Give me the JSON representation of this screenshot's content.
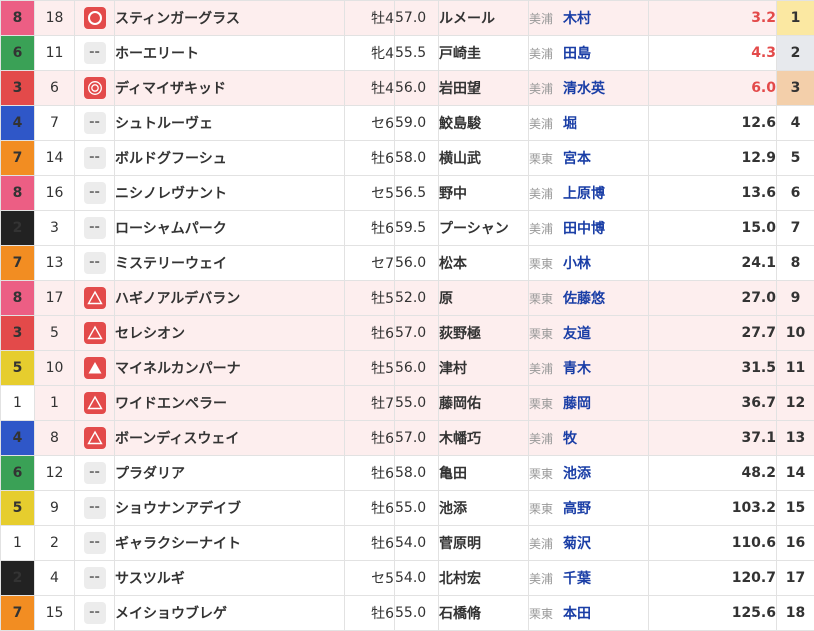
{
  "colors": {
    "waku1": "#ffffff",
    "waku2": "#222222",
    "waku3": "#e34a4a",
    "waku4": "#2f57c8",
    "waku5": "#e6cd2e",
    "waku6": "#3aa156",
    "waku7": "#f28d22",
    "waku8": "#ec5e84",
    "mark_red": "#e34a4a",
    "name_blue": "#1a3ea6",
    "fav_odds": "#e34a4a"
  },
  "rows": [
    {
      "waku": "8",
      "umaban": "18",
      "mark": "double-circle",
      "name": "スティンガーグラス",
      "sexage": "牡4",
      "kinryo": "57.0",
      "jockey": "ルメール",
      "aff": "美浦",
      "trainer": "木村",
      "odds": "3.2",
      "ninki": "1",
      "hl": true
    },
    {
      "waku": "6",
      "umaban": "11",
      "mark": "none",
      "name": "ホーエリート",
      "sexage": "牝4",
      "kinryo": "55.5",
      "jockey": "戸崎圭",
      "aff": "美浦",
      "trainer": "田島",
      "odds": "4.3",
      "ninki": "2",
      "hl": false
    },
    {
      "waku": "3",
      "umaban": "6",
      "mark": "target",
      "name": "ディマイザキッド",
      "sexage": "牡4",
      "kinryo": "56.0",
      "jockey": "岩田望",
      "aff": "美浦",
      "trainer": "清水英",
      "odds": "6.0",
      "ninki": "3",
      "hl": true
    },
    {
      "waku": "4",
      "umaban": "7",
      "mark": "none",
      "name": "シュトルーヴェ",
      "sexage": "セ6",
      "kinryo": "59.0",
      "jockey": "鮫島駿",
      "aff": "美浦",
      "trainer": "堀",
      "odds": "12.6",
      "ninki": "4",
      "hl": false
    },
    {
      "waku": "7",
      "umaban": "14",
      "mark": "none",
      "name": "ボルドグフーシュ",
      "sexage": "牡6",
      "kinryo": "58.0",
      "jockey": "横山武",
      "aff": "栗東",
      "trainer": "宮本",
      "odds": "12.9",
      "ninki": "5",
      "hl": false
    },
    {
      "waku": "8",
      "umaban": "16",
      "mark": "none",
      "name": "ニシノレヴナント",
      "sexage": "セ5",
      "kinryo": "56.5",
      "jockey": "野中",
      "aff": "美浦",
      "trainer": "上原博",
      "odds": "13.6",
      "ninki": "6",
      "hl": false
    },
    {
      "waku": "2",
      "umaban": "3",
      "mark": "none",
      "name": "ローシャムパーク",
      "sexage": "牡6",
      "kinryo": "59.5",
      "jockey": "プーシャン",
      "aff": "美浦",
      "trainer": "田中博",
      "odds": "15.0",
      "ninki": "7",
      "hl": false
    },
    {
      "waku": "7",
      "umaban": "13",
      "mark": "none",
      "name": "ミステリーウェイ",
      "sexage": "セ7",
      "kinryo": "56.0",
      "jockey": "松本",
      "aff": "栗東",
      "trainer": "小林",
      "odds": "24.1",
      "ninki": "8",
      "hl": false
    },
    {
      "waku": "8",
      "umaban": "17",
      "mark": "triangle-outline",
      "name": "ハギノアルデバラン",
      "sexage": "牡5",
      "kinryo": "52.0",
      "jockey": "原",
      "aff": "栗東",
      "trainer": "佐藤悠",
      "odds": "27.0",
      "ninki": "9",
      "hl": true
    },
    {
      "waku": "3",
      "umaban": "5",
      "mark": "triangle-outline",
      "name": "セレシオン",
      "sexage": "牡6",
      "kinryo": "57.0",
      "jockey": "荻野極",
      "aff": "栗東",
      "trainer": "友道",
      "odds": "27.7",
      "ninki": "10",
      "hl": true
    },
    {
      "waku": "5",
      "umaban": "10",
      "mark": "triangle-filled",
      "name": "マイネルカンパーナ",
      "sexage": "牡5",
      "kinryo": "56.0",
      "jockey": "津村",
      "aff": "美浦",
      "trainer": "青木",
      "odds": "31.5",
      "ninki": "11",
      "hl": true
    },
    {
      "waku": "1",
      "umaban": "1",
      "mark": "triangle-outline",
      "name": "ワイドエンペラー",
      "sexage": "牡7",
      "kinryo": "55.0",
      "jockey": "藤岡佑",
      "aff": "栗東",
      "trainer": "藤岡",
      "odds": "36.7",
      "ninki": "12",
      "hl": true
    },
    {
      "waku": "4",
      "umaban": "8",
      "mark": "triangle-outline",
      "name": "ボーンディスウェイ",
      "sexage": "牡6",
      "kinryo": "57.0",
      "jockey": "木幡巧",
      "aff": "美浦",
      "trainer": "牧",
      "odds": "37.1",
      "ninki": "13",
      "hl": true
    },
    {
      "waku": "6",
      "umaban": "12",
      "mark": "none",
      "name": "プラダリア",
      "sexage": "牡6",
      "kinryo": "58.0",
      "jockey": "亀田",
      "aff": "栗東",
      "trainer": "池添",
      "odds": "48.2",
      "ninki": "14",
      "hl": false
    },
    {
      "waku": "5",
      "umaban": "9",
      "mark": "none",
      "name": "ショウナンアデイブ",
      "sexage": "牡6",
      "kinryo": "55.0",
      "jockey": "池添",
      "aff": "栗東",
      "trainer": "高野",
      "odds": "103.2",
      "ninki": "15",
      "hl": false
    },
    {
      "waku": "1",
      "umaban": "2",
      "mark": "none",
      "name": "ギャラクシーナイト",
      "sexage": "牡6",
      "kinryo": "54.0",
      "jockey": "菅原明",
      "aff": "美浦",
      "trainer": "菊沢",
      "odds": "110.6",
      "ninki": "16",
      "hl": false
    },
    {
      "waku": "2",
      "umaban": "4",
      "mark": "none",
      "name": "サスツルギ",
      "sexage": "セ5",
      "kinryo": "54.0",
      "jockey": "北村宏",
      "aff": "美浦",
      "trainer": "千葉",
      "odds": "120.7",
      "ninki": "17",
      "hl": false
    },
    {
      "waku": "7",
      "umaban": "15",
      "mark": "none",
      "name": "メイショウブレゲ",
      "sexage": "牡6",
      "kinryo": "55.0",
      "jockey": "石橋脩",
      "aff": "栗東",
      "trainer": "本田",
      "odds": "125.6",
      "ninki": "18",
      "hl": false
    }
  ]
}
